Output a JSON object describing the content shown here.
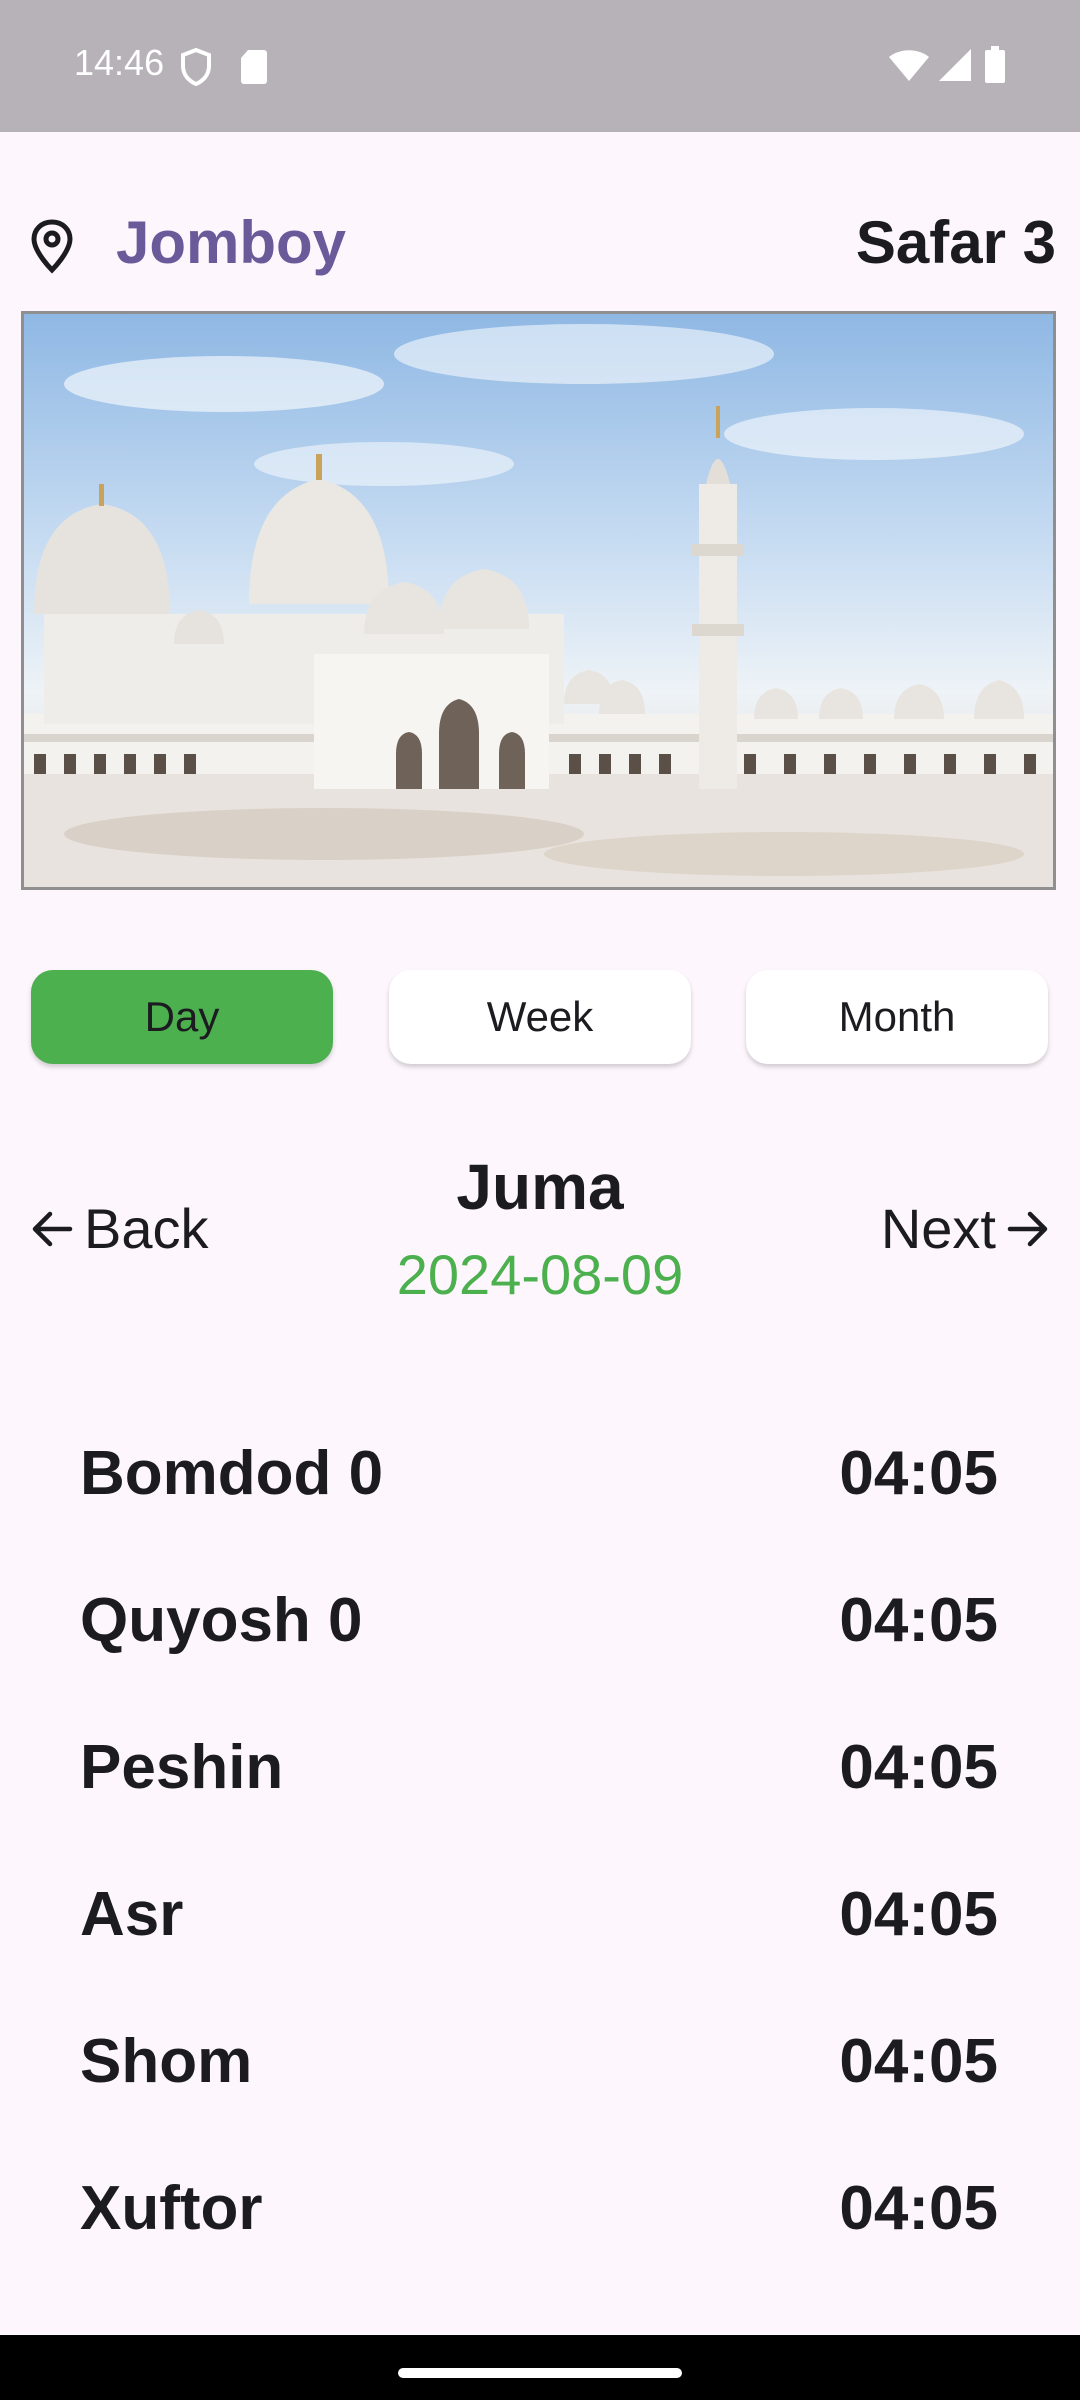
{
  "status_bar": {
    "time": "14:46",
    "icons": [
      "shield-icon",
      "sd-card-icon",
      "wifi-icon",
      "signal-icon",
      "battery-icon"
    ]
  },
  "header": {
    "location_icon": "location-pin-icon",
    "city": "Jomboy",
    "hijri_date": "Safar 3"
  },
  "banner": {
    "description_icon": "mosque-image"
  },
  "tabs": [
    {
      "label": "Day",
      "active": true
    },
    {
      "label": "Week",
      "active": false
    },
    {
      "label": "Month",
      "active": false
    }
  ],
  "nav": {
    "back_label": "Back",
    "next_label": "Next",
    "day_name": "Juma",
    "date": "2024-08-09"
  },
  "prayers": [
    {
      "name": "Bomdod 0",
      "time": "04:05"
    },
    {
      "name": "Quyosh 0",
      "time": "04:05"
    },
    {
      "name": "Peshin",
      "time": "04:05"
    },
    {
      "name": "Asr",
      "time": "04:05"
    },
    {
      "name": "Shom",
      "time": "04:05"
    },
    {
      "name": "Xuftor",
      "time": "04:05"
    }
  ],
  "colors": {
    "accent_green": "#4cb04f",
    "city_purple": "#6a5a9a",
    "background": "#fdf7fd"
  }
}
